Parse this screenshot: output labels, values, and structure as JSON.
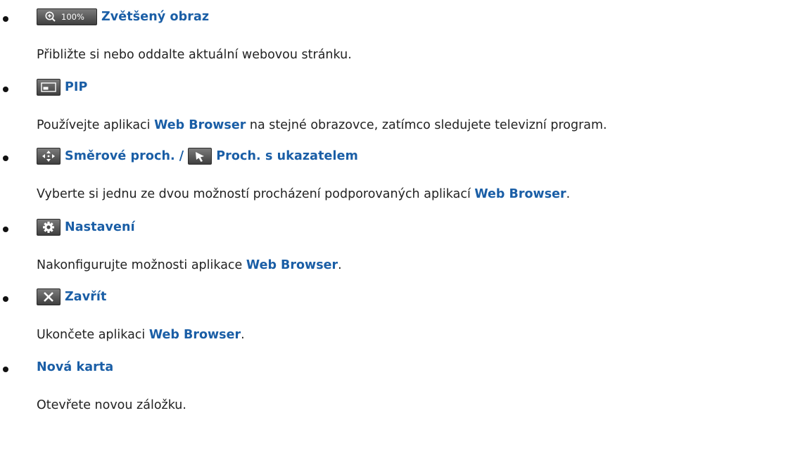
{
  "items": [
    {
      "icon": "zoom-in-icon",
      "icon_text": "100%",
      "label": "Zvětšený obraz",
      "description": "Přibližte si nebo oddalte aktuální webovou stránku."
    },
    {
      "icon": "pip-icon",
      "label": "PIP",
      "description_pre": "Používejte aplikaci ",
      "description_kw": "Web Browser",
      "description_post": " na stejné obrazovce, zatímco sledujete televizní program."
    },
    {
      "icon": "directional-navigation-icon",
      "label": "Směrové proch.",
      "separator": "/",
      "icon2": "pointer-navigation-icon",
      "label2": "Proch. s ukazatelem",
      "description_pre": "Vyberte si jednu ze dvou možností procházení podporovaných aplikací ",
      "description_kw": "Web Browser",
      "description_post": "."
    },
    {
      "icon": "gear-icon",
      "label": "Nastavení",
      "description_pre": "Nakonfigurujte možnosti aplikace ",
      "description_kw": "Web Browser",
      "description_post": "."
    },
    {
      "icon": "close-icon",
      "label": "Zavřít",
      "description_pre": "Ukončete aplikaci ",
      "description_kw": "Web Browser",
      "description_post": "."
    },
    {
      "label": "Nová karta",
      "description": "Otevřete novou záložku."
    }
  ],
  "colors": {
    "accent": "#1a5ea6",
    "text": "#222222",
    "icon_bg": "#5a5a5a"
  }
}
